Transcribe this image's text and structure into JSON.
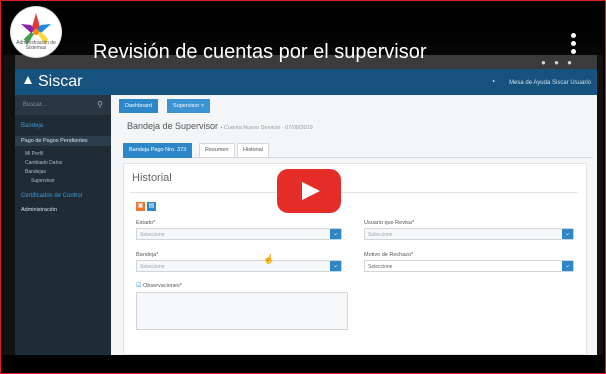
{
  "video": {
    "title": "Revisión de cuentas por el supervisor",
    "channel_logo_text": "Administración de Sistemas",
    "colors": {
      "play_button": "#e52d27",
      "border": "#e0201a"
    }
  },
  "app": {
    "brand": "Siscar",
    "user_text": "Mesa de Ayuda Siscar Usuario",
    "sidebar": {
      "search_placeholder": "Buscar...",
      "section_1": "Bandeja",
      "items": [
        "Pago de Pagos Pendientes",
        "Mi Perfil",
        "Cambiado Datos",
        "Bandejas",
        "Supervisor"
      ],
      "section_2": "Certificados de Control",
      "item_admin": "Administración"
    },
    "tabs": [
      "Dashboard",
      "Supervisor ×"
    ],
    "page_title": "Bandeja de Supervisor",
    "page_subtitle": "• Cuenta Nuevo Servicio - 07/08/2019",
    "subtabs": [
      "Bandeja Pago Nro. 373",
      "Resumen",
      "Historial"
    ],
    "panel": {
      "title": "Historial",
      "estado_label": "Estado*",
      "estado_value": "Seleccione",
      "usuario_label": "Usuario que Revisa*",
      "usuario_value": "Seleccione",
      "bandeja_label": "Bandeja*",
      "bandeja_value": "Seleccione",
      "motivo_label": "Motivo de Rechazo*",
      "motivo_value": "Seleccione",
      "observaciones_label": "Observaciones*"
    }
  }
}
